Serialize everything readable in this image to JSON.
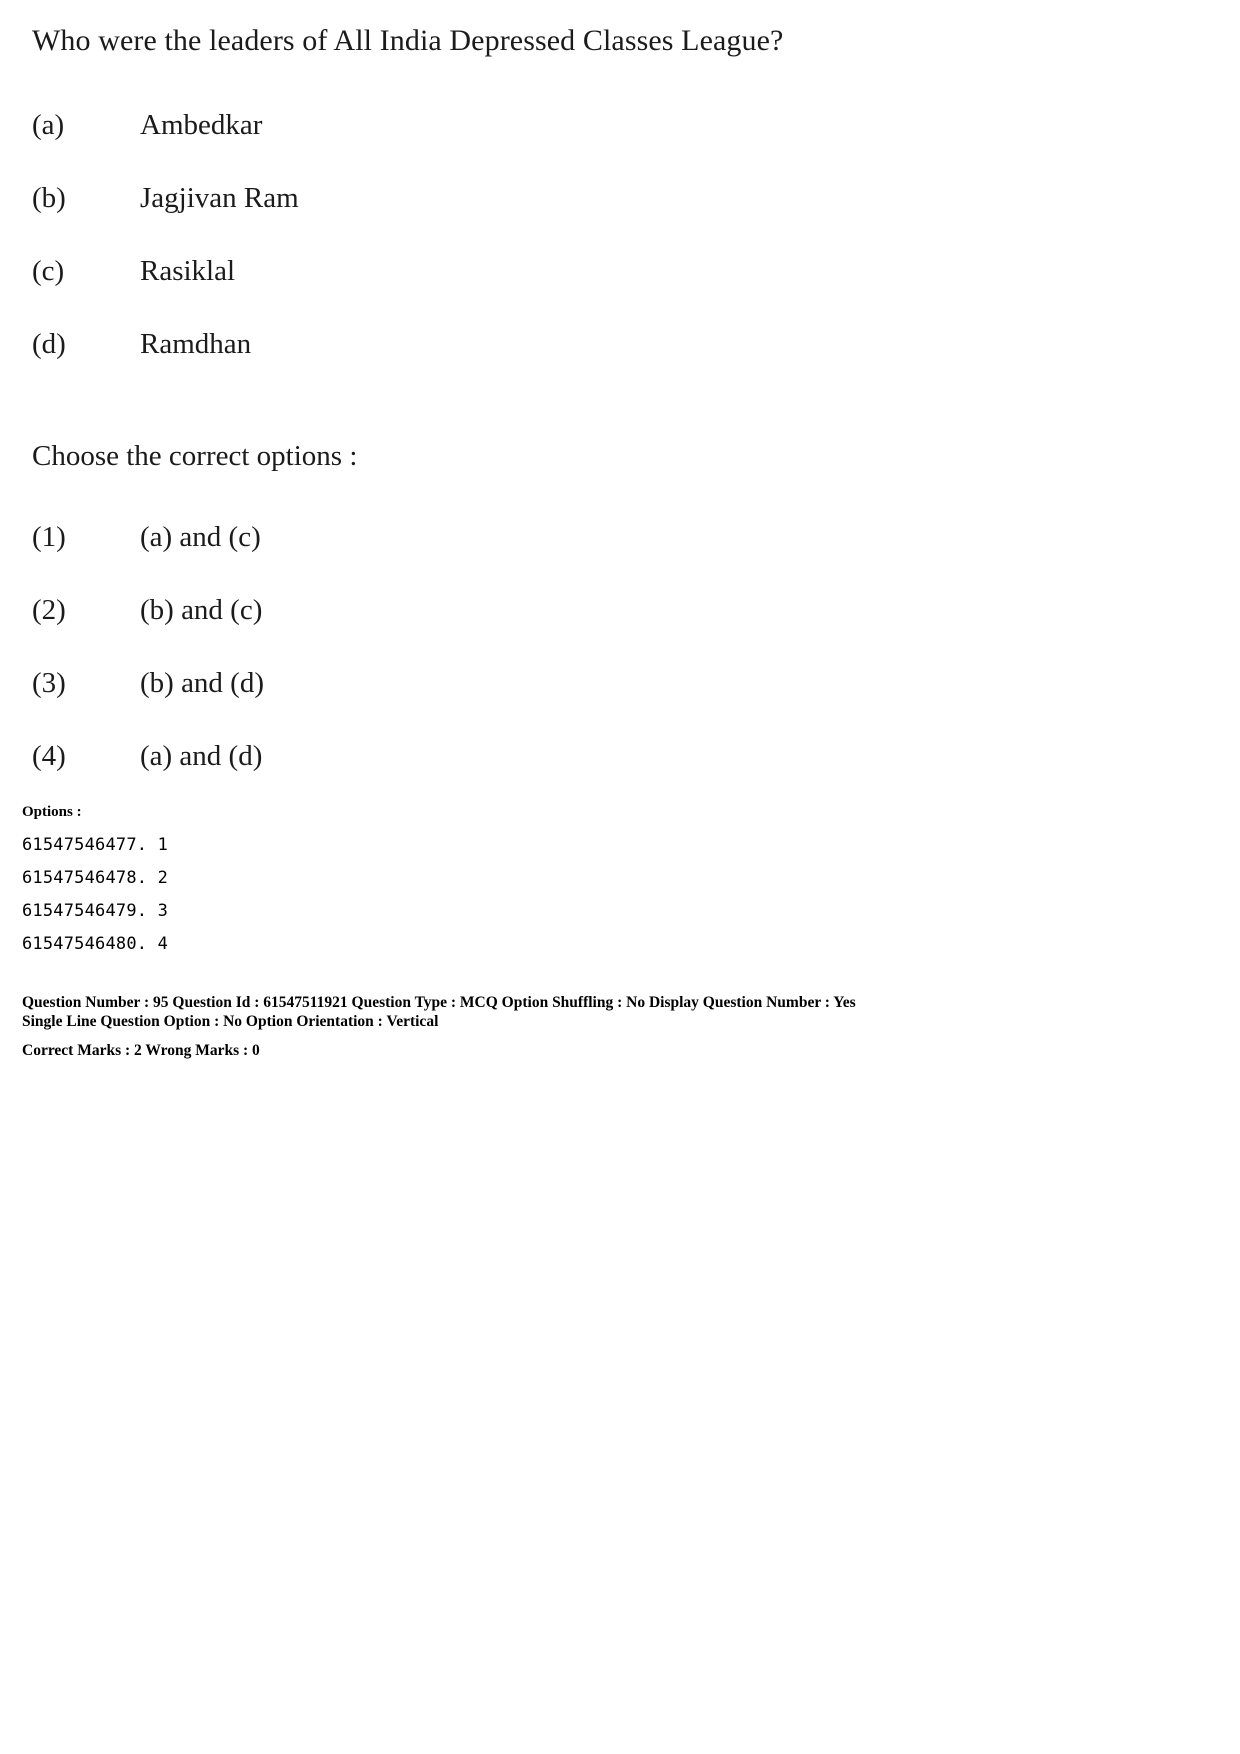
{
  "question": {
    "stem": "Who were the leaders of All India Depressed Classes League?",
    "statements": [
      {
        "label": "(a)",
        "text": "Ambedkar"
      },
      {
        "label": "(b)",
        "text": "Jagjivan Ram"
      },
      {
        "label": "(c)",
        "text": "Rasiklal"
      },
      {
        "label": "(d)",
        "text": "Ramdhan"
      }
    ],
    "instruction": "Choose the correct options :",
    "choices": [
      {
        "label": "(1)",
        "text": "(a) and (c)"
      },
      {
        "label": "(2)",
        "text": "(b) and (c)"
      },
      {
        "label": "(3)",
        "text": "(b) and (d)"
      },
      {
        "label": "(4)",
        "text": "(a) and (d)"
      }
    ]
  },
  "options_section": {
    "heading": "Options :",
    "items": [
      "61547546477. 1",
      "61547546478. 2",
      "61547546479. 3",
      "61547546480. 4"
    ]
  },
  "metadata": {
    "line1": "Question Number : 95  Question Id : 61547511921  Question Type : MCQ  Option Shuffling : No  Display Question Number : Yes",
    "line2": "Single Line Question Option : No  Option Orientation : Vertical",
    "line3": "Correct Marks : 2  Wrong Marks : 0"
  }
}
